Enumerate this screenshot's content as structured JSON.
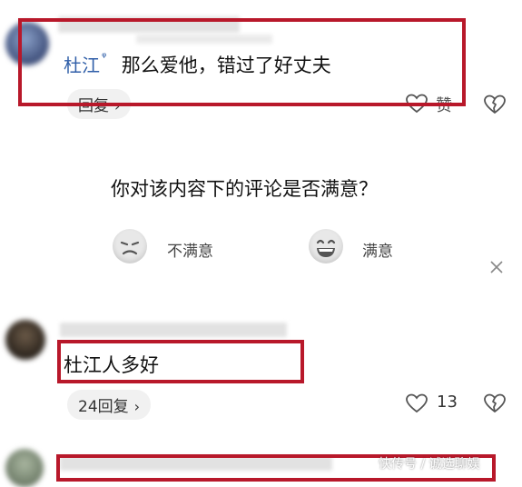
{
  "comment1": {
    "username": "杜江",
    "text": "那么爱他，错过了好丈夫",
    "reply_label": "回复",
    "like_label": "赞"
  },
  "survey": {
    "question": "你对该内容下的评论是否满意？",
    "option_unsatisfied": "不满意",
    "option_satisfied": "满意"
  },
  "comment2": {
    "text": "杜江人多好",
    "reply_label": "24回复",
    "like_count": "13"
  },
  "watermark": "快传号 / 诚选聊娱",
  "colors": {
    "highlight_box": "#b8182a",
    "username": "#2f5ea8"
  },
  "icons": [
    "heart-icon",
    "broken-heart-icon",
    "close-icon",
    "chevron-right-icon",
    "verified-tag-icon"
  ]
}
